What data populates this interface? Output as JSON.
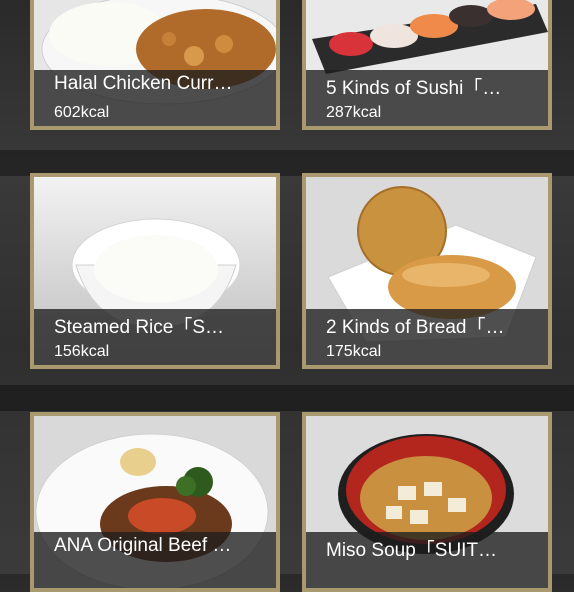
{
  "menu_items": [
    {
      "name": "Halal Chicken Curr…",
      "kcal": "602kcal",
      "image": "chicken-curry-photo"
    },
    {
      "name": "5 Kinds of Sushi「…",
      "kcal": "287kcal",
      "image": "sushi-photo"
    },
    {
      "name": "Steamed Rice「S…",
      "kcal": "156kcal",
      "image": "steamed-rice-photo"
    },
    {
      "name": "2 Kinds of Bread「…",
      "kcal": "175kcal",
      "image": "bread-photo"
    },
    {
      "name": "ANA Original Beef …",
      "kcal": "",
      "image": "beef-hamburg-photo"
    },
    {
      "name": "Miso Soup「SUIT…",
      "kcal": "",
      "image": "miso-soup-photo"
    }
  ],
  "colors": {
    "frame": "#a89a6e",
    "caption_bg": "#1e1e1e",
    "background": "#333333"
  }
}
